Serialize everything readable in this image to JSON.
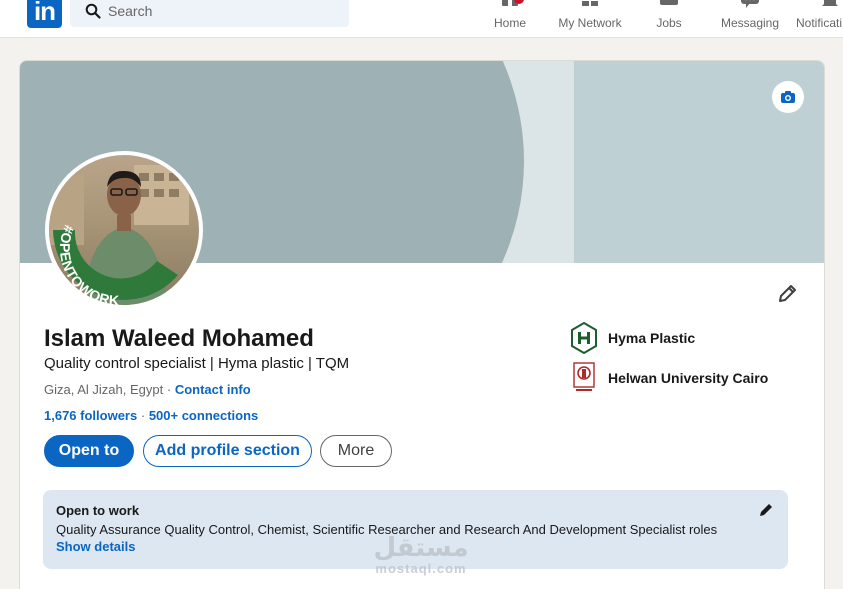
{
  "nav": {
    "logo_text": "in",
    "search_placeholder": "Search",
    "items": [
      {
        "label": "Home",
        "icon": "home-icon",
        "has_badge": true
      },
      {
        "label": "My Network",
        "icon": "network-icon",
        "has_badge": false
      },
      {
        "label": "Jobs",
        "icon": "briefcase-icon",
        "has_badge": false
      },
      {
        "label": "Messaging",
        "icon": "chat-icon",
        "has_badge": false
      },
      {
        "label": "Notificati",
        "icon": "bell-icon",
        "has_badge": false
      }
    ],
    "badge_color": "#cb112d"
  },
  "profile": {
    "avatar_frame_text": "#OPENTOWORK",
    "name": "Islam Waleed Mohamed",
    "headline": "Quality control specialist | Hyma plastic | TQM",
    "location": "Giza, Al Jizah, Egypt",
    "location_separator": "·",
    "contact_info": "Contact info",
    "followers": "1,676 followers",
    "stats_separator": "·",
    "connections": "500+ connections"
  },
  "actions": {
    "open_to": "Open to",
    "add_section": "Add profile section",
    "more": "More"
  },
  "experience": [
    {
      "label": "Hyma Plastic",
      "logo": "hyma-logo"
    },
    {
      "label": "Helwan University Cairo",
      "logo": "helwan-university-logo"
    }
  ],
  "open_to_work": {
    "title": "Open to work",
    "roles": "Quality Assurance Quality Control, Chemist, Scientific Researcher and Research And Development Specialist roles",
    "show_details": "Show details"
  },
  "watermark": {
    "arabic": "مستقل",
    "latin": "mostaql.com"
  },
  "colors": {
    "brand": "#0a66c2",
    "open_to_work_green": "#2f7a3b",
    "banner_dark": "#9eb1b5",
    "banner_light": "#dbe5e7",
    "banner_right": "#bed0d4",
    "open_to_work_bg": "#dde7f1"
  }
}
